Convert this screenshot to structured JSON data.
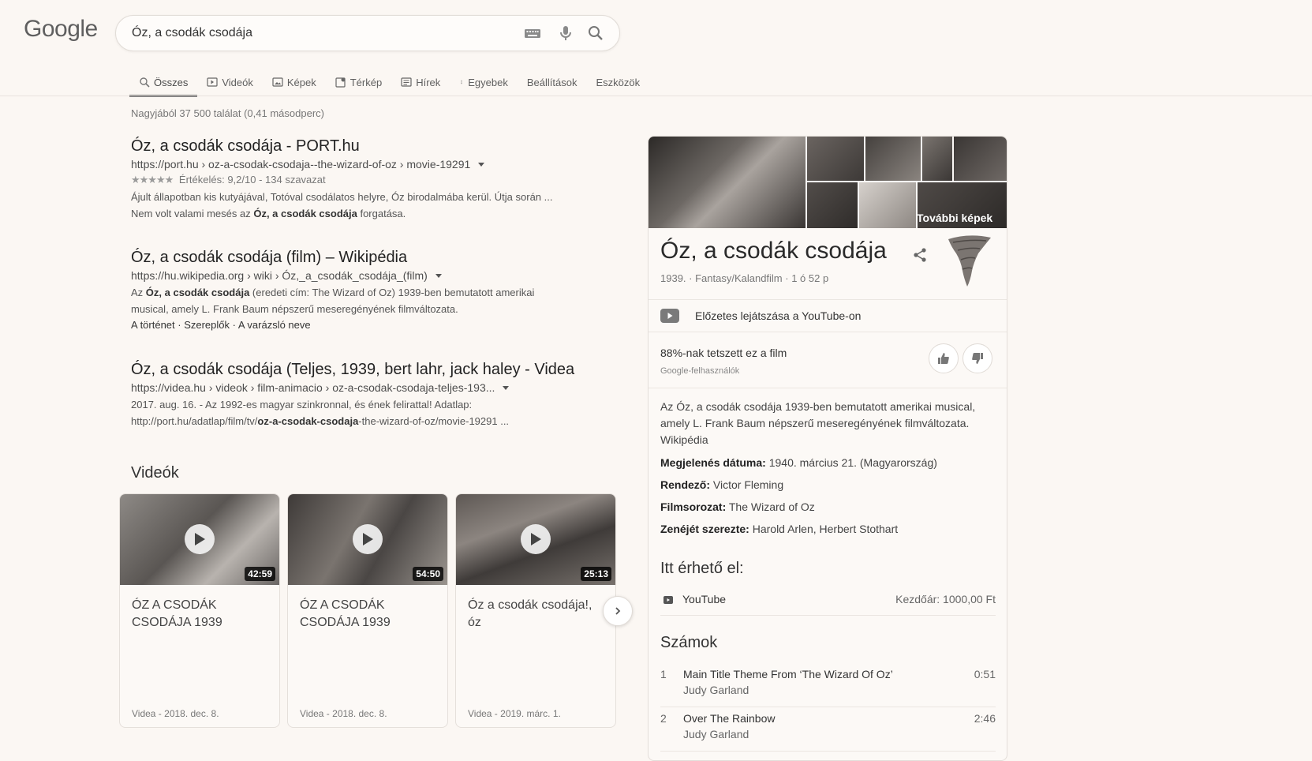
{
  "header": {
    "logo_text": "Google",
    "query": "Óz, a csodák csodája",
    "icons": [
      "keyboard-icon",
      "mic-icon",
      "search-icon"
    ]
  },
  "tabs": [
    {
      "label": "Összes",
      "icon": "search-icon",
      "active": true
    },
    {
      "label": "Videók",
      "icon": "video-icon"
    },
    {
      "label": "Képek",
      "icon": "image-icon"
    },
    {
      "label": "Térkép",
      "icon": "map-icon"
    },
    {
      "label": "Hírek",
      "icon": "news-icon"
    },
    {
      "label": "Egyebek",
      "icon": "more-vert-icon"
    },
    {
      "label": "Beállítások"
    },
    {
      "label": "Eszközök"
    }
  ],
  "stats": "Nagyjából 37 500 találat (0,41 másodperc)",
  "results": [
    {
      "title": "Óz, a csodák csodája - PORT.hu",
      "url": "https://port.hu › oz-a-csodak-csodaja--the-wizard-of-oz › movie-19291",
      "stars": "★★★★★",
      "rating": "Értékelés: 9,2/10 - 134 szavazat",
      "snippet_1": "Ájult állapotban kis kutyájával, Totóval csodálatos helyre, Óz birodalmába kerül. Útja során ...",
      "snippet_2a": "Nem volt valami mesés az ",
      "snippet_2b": "Óz, a csodák csodája",
      "snippet_2c": " forgatása."
    },
    {
      "title": "Óz, a csodák csodája (film) – Wikipédia",
      "url": "https://hu.wikipedia.org › wiki › Óz,_a_csodák_csodája_(film)",
      "snippet_1a": "Az ",
      "snippet_1b": "Óz, a csodák csodája",
      "snippet_1c": " (eredeti cím: The Wizard of Oz) 1939-ben bemutatott amerikai",
      "snippet_2": "musical, amely L. Frank Baum népszerű meseregényének filmváltozata.",
      "links": "A történet · Szereplők · A varázsló neve"
    },
    {
      "title": "Óz, a csodák csodája (Teljes, 1939, bert lahr, jack haley - Videa",
      "url": "https://videa.hu › videok › film-animacio › oz-a-csodak-csodaja-teljes-193...",
      "snippet_1": "2017. aug. 16. - Az 1992-es magyar szinkronnal, és ének felirattal! Adatlap:",
      "snippet_2a": "http://port.hu/adatlap/film/tv/",
      "snippet_2b": "oz-a-csodak-csodaja",
      "snippet_2c": "-the-wizard-of-oz/movie-19291 ..."
    }
  ],
  "videos": {
    "heading": "Videók",
    "items": [
      {
        "title": "ÓZ A CSODÁK CSODÁJA 1939",
        "duration": "42:59",
        "source": "Videa - 2018. dec. 8."
      },
      {
        "title": "ÓZ A CSODÁK CSODÁJA 1939",
        "duration": "54:50",
        "source": "Videa - 2018. dec. 8."
      },
      {
        "title": "Óz a csodák csodája!, óz",
        "duration": "25:13",
        "source": "Videa - 2019. márc. 1."
      }
    ]
  },
  "panel": {
    "more_images": "További képek",
    "title": "Óz, a csodák csodája",
    "subtitle": "1939. · Fantasy/Kalandfilm · 1 ó 52 p",
    "youtube_label": "Előzetes lejátszása a YouTube-on",
    "like_text": "88%-nak tetszett ez a film",
    "like_sub": "Google-felhasználók",
    "description": "Az Óz, a csodák csodája 1939-ben bemutatott amerikai musical, amely L. Frank Baum népszerű meseregényének filmváltozata.",
    "description_source": "Wikipédia",
    "facts": [
      {
        "label": "Megjelenés dátuma:",
        "value": " 1940. március 21. (Magyarország)"
      },
      {
        "label": "Rendező:",
        "value": " Victor Fleming"
      },
      {
        "label": "Filmsorozat:",
        "value": " The Wizard of Oz"
      },
      {
        "label": "Zenéjét szerezte:",
        "value": " Harold Arlen, Herbert Stothart"
      }
    ],
    "available_heading": "Itt érhető el:",
    "available": {
      "name": "YouTube",
      "price": "Kezdőár: 1000,00 Ft"
    },
    "tracks_heading": "Számok",
    "tracks": [
      {
        "num": "1",
        "name": "Main Title Theme From ‘The Wizard Of Oz’",
        "artist": "Judy Garland",
        "length": "0:51"
      },
      {
        "num": "2",
        "name": "Over The Rainbow",
        "artist": "Judy Garland",
        "length": "2:46"
      }
    ]
  }
}
